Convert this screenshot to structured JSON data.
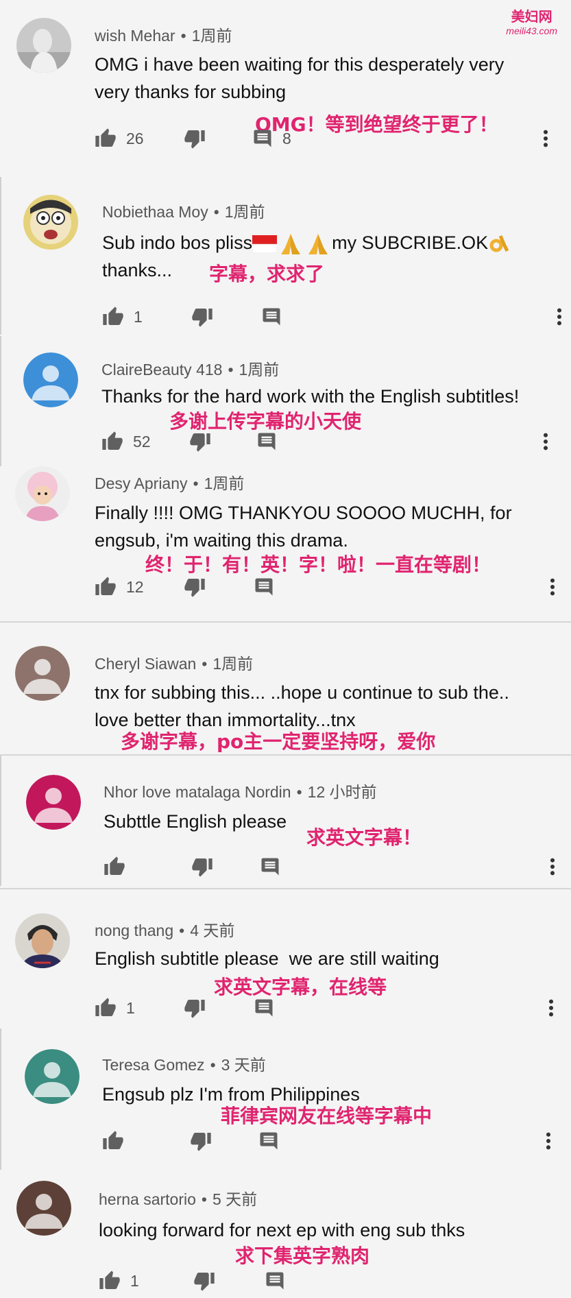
{
  "watermark": {
    "title": "美妇网",
    "site": "meili43.com"
  },
  "comments": [
    {
      "author": "wish Mehar",
      "time": "1周前",
      "text": "OMG i have been waiting for this desperately very very thanks for subbing",
      "translation": "OMG！等到绝望终于更了！",
      "likes": "26",
      "replies": "8",
      "avatar": "photo"
    },
    {
      "author": "Nobiethaa Moy",
      "time": "1周前",
      "text_parts": [
        "Sub indo bos pliss",
        "my SUBCRIBE.OK",
        "thanks..."
      ],
      "translation": "字幕，求求了",
      "likes": "1",
      "avatar": "cartoon"
    },
    {
      "author": "ClaireBeauty 418",
      "time": "1周前",
      "text": "Thanks for the hard work with the English subtitles!",
      "translation": "多谢上传字幕的小天使",
      "likes": "52",
      "avatar": "default-blue"
    },
    {
      "author": "Desy Apriany",
      "time": "1周前",
      "text": "Finally !!!! OMG THANKYOU SOOOO MUCHH, for engsub, i'm waiting this drama.",
      "translation": "终！于！有！英！字！啦！一直在等剧！",
      "likes": "12",
      "avatar": "baby"
    },
    {
      "author": "Cheryl Siawan",
      "time": "1周前",
      "text": "tnx for subbing this... ..hope u continue to sub the.. love better than immortality...tnx",
      "translation": "多谢字幕，po主一定要坚持呀，爱你",
      "avatar": "default-brown"
    },
    {
      "author": "Nhor love matalaga Nordin",
      "time": "12 小时前",
      "text": "Subttle English please",
      "translation": "求英文字幕！",
      "avatar": "default-crimson"
    },
    {
      "author": "nong thang",
      "time": "4 天前",
      "text": "English subtitle please  we are still waiting",
      "translation": "求英文字幕，在线等",
      "likes": "1",
      "avatar": "man"
    },
    {
      "author": "Teresa Gomez",
      "time": "3 天前",
      "text": "Engsub plz I'm from Philippines",
      "translation": "菲律宾网友在线等字幕中",
      "avatar": "default-teal"
    },
    {
      "author": "herna sartorio",
      "time": "5 天前",
      "text": "looking forward for next ep with eng sub thks",
      "translation": "求下集英字熟肉",
      "likes": "1",
      "avatar": "default-darkbrown"
    }
  ],
  "colors": {
    "accent_translation": "#e0246f",
    "icon": "#606060",
    "background": "#f4f4f4"
  }
}
